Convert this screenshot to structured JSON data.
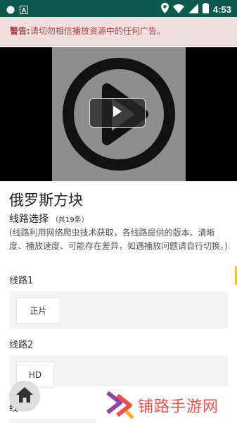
{
  "status_bar": {
    "time": "4:53",
    "left_icons": [
      "circle-notification-icon",
      "a-box-icon"
    ],
    "right_icons": [
      "location-icon",
      "wifi-icon",
      "signal-icon",
      "battery-icon"
    ]
  },
  "warning": {
    "prefix": "警告:",
    "text": "请切勿相信播放资源中的任何广告。"
  },
  "video": {
    "play_icon": "play-icon"
  },
  "title": "俄罗斯方块",
  "routes": {
    "heading": "线路选择",
    "count": "（共19条）",
    "note": "(线路利用网络爬虫技术获取，各线路提供的版本、清晰度、播放速度、可能存在差异，如遇播放问题请自行切换。)",
    "sections": [
      {
        "label": "线路1",
        "episodes": [
          "正片"
        ]
      },
      {
        "label": "线路2",
        "episodes": [
          "HD"
        ]
      },
      {
        "label": "线",
        "episodes": []
      }
    ]
  },
  "home_button": {
    "icon": "home-icon"
  },
  "watermark": {
    "text": "铺路手游网",
    "logo": "brand-logo-icon"
  },
  "colors": {
    "status_bar": "#0b5a4b",
    "warning_bg": "#f2dede",
    "warning_text": "#a94442",
    "watermark": "#e8534f"
  }
}
